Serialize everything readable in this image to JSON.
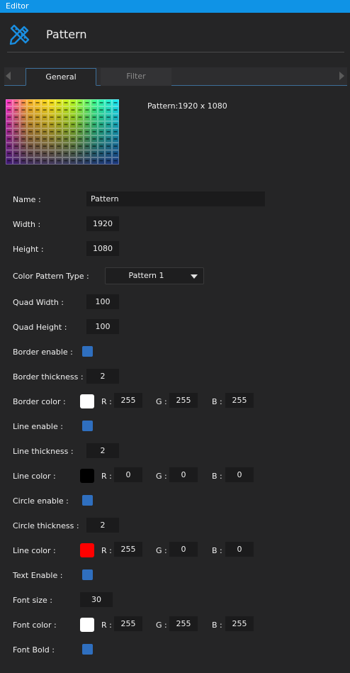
{
  "window": {
    "title": "Editor"
  },
  "header": {
    "title": "Pattern",
    "icon": "pencil-ruler-icon"
  },
  "tabs": [
    {
      "label": "General",
      "active": true
    },
    {
      "label": "Filter",
      "active": false
    }
  ],
  "preview": {
    "label": "Pattern:1920 x 1080"
  },
  "form": {
    "name": {
      "label": "Name :",
      "value": "Pattern"
    },
    "width": {
      "label": "Width :",
      "value": "1920"
    },
    "height": {
      "label": "Height :",
      "value": "1080"
    },
    "color_pattern_type": {
      "label": "Color Pattern Type :",
      "value": "Pattern 1"
    },
    "quad_width": {
      "label": "Quad Width :",
      "value": "100"
    },
    "quad_height": {
      "label": "Quad Height :",
      "value": "100"
    },
    "border_enable": {
      "label": "Border enable :",
      "checked": true
    },
    "border_thickness": {
      "label": "Border thickness :",
      "value": "2"
    },
    "border_color": {
      "label": "Border color :",
      "swatch": "#ffffff",
      "r": "255",
      "g": "255",
      "b": "255"
    },
    "line_enable": {
      "label": "Line enable :",
      "checked": true
    },
    "line_thickness": {
      "label": "Line thickness :",
      "value": "2"
    },
    "line_color": {
      "label": "Line color :",
      "swatch": "#000000",
      "r": "0",
      "g": "0",
      "b": "0"
    },
    "circle_enable": {
      "label": "Circle enable :",
      "checked": true
    },
    "circle_thickness": {
      "label": "Circle thickness :",
      "value": "2"
    },
    "circle_color": {
      "label": "Line color :",
      "swatch": "#ff0000",
      "r": "255",
      "g": "0",
      "b": "0"
    },
    "text_enable": {
      "label": "Text Enable :",
      "checked": true
    },
    "font_size": {
      "label": "Font size :",
      "value": "30"
    },
    "font_color": {
      "label": "Font color :",
      "swatch": "#ffffff",
      "r": "255",
      "g": "255",
      "b": "255"
    },
    "font_bold": {
      "label": "Font Bold :",
      "checked": true
    }
  },
  "channel_labels": {
    "r": "R :",
    "g": "G :",
    "b": "B :"
  },
  "colors": {
    "titlebar": "#0f93e6",
    "checkbox": "#2f6fbf",
    "tab_border": "#3d6f99"
  }
}
